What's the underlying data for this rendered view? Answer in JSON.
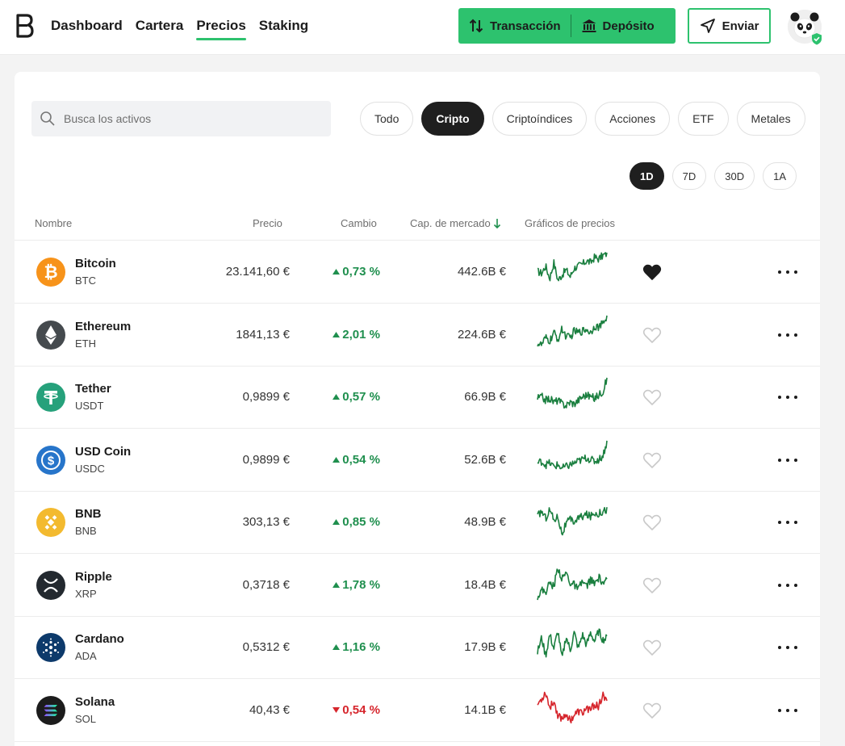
{
  "nav": {
    "items": [
      {
        "label": "Dashboard",
        "active": false
      },
      {
        "label": "Cartera",
        "active": false
      },
      {
        "label": "Precios",
        "active": true
      },
      {
        "label": "Staking",
        "active": false
      }
    ]
  },
  "actions": {
    "transaction_label": "Transacción",
    "deposit_label": "Depósito",
    "send_label": "Enviar",
    "accent": "#2dc26e"
  },
  "search": {
    "placeholder": "Busca los activos"
  },
  "filters": [
    {
      "label": "Todo",
      "active": false
    },
    {
      "label": "Cripto",
      "active": true
    },
    {
      "label": "Criptoíndices",
      "active": false
    },
    {
      "label": "Acciones",
      "active": false
    },
    {
      "label": "ETF",
      "active": false
    },
    {
      "label": "Metales",
      "active": false
    }
  ],
  "periods": [
    {
      "label": "1D",
      "active": true
    },
    {
      "label": "7D",
      "active": false
    },
    {
      "label": "30D",
      "active": false
    },
    {
      "label": "1A",
      "active": false
    }
  ],
  "table": {
    "columns": {
      "name": "Nombre",
      "price": "Precio",
      "change": "Cambio",
      "mcap": "Cap. de mercado",
      "chart": "Gráficos de precios"
    },
    "rows": [
      {
        "name": "Bitcoin",
        "symbol": "BTC",
        "price": "23.141,60 €",
        "change": "0,73 %",
        "direction": "up",
        "mcap": "442.6B €",
        "favorite": true,
        "icon": "bitcoin-icon",
        "color": "#f7931a",
        "trend": [
          0.45,
          0.4,
          0.6,
          0.25,
          0.7,
          0.2,
          0.35,
          0.5,
          0.3,
          0.55,
          0.6,
          0.65,
          0.75,
          0.7,
          0.85,
          0.8,
          0.9,
          0.95
        ]
      },
      {
        "name": "Ethereum",
        "symbol": "ETH",
        "price": "1841,13 €",
        "change": "2,01 %",
        "direction": "up",
        "mcap": "224.6B €",
        "favorite": false,
        "icon": "ethereum-icon",
        "color": "#454a4e",
        "trend": [
          0.2,
          0.15,
          0.35,
          0.25,
          0.5,
          0.3,
          0.6,
          0.4,
          0.35,
          0.55,
          0.5,
          0.55,
          0.6,
          0.5,
          0.7,
          0.65,
          0.75,
          0.95
        ]
      },
      {
        "name": "Tether",
        "symbol": "USDT",
        "price": "0,9899 €",
        "change": "0,57 %",
        "direction": "up",
        "mcap": "66.9B €",
        "favorite": false,
        "icon": "tether-icon",
        "color": "#26a17b",
        "trend": [
          0.4,
          0.45,
          0.35,
          0.4,
          0.3,
          0.35,
          0.25,
          0.2,
          0.3,
          0.25,
          0.35,
          0.45,
          0.5,
          0.45,
          0.4,
          0.5,
          0.6,
          0.95
        ]
      },
      {
        "name": "USD Coin",
        "symbol": "USDC",
        "price": "0,9899 €",
        "change": "0,54 %",
        "direction": "up",
        "mcap": "52.6B €",
        "favorite": false,
        "icon": "usd-coin-icon",
        "color": "#2775ca",
        "trend": [
          0.35,
          0.4,
          0.3,
          0.35,
          0.25,
          0.3,
          0.2,
          0.25,
          0.3,
          0.35,
          0.4,
          0.45,
          0.5,
          0.45,
          0.4,
          0.45,
          0.55,
          0.95
        ]
      },
      {
        "name": "BNB",
        "symbol": "BNB",
        "price": "303,13 €",
        "change": "0,85 %",
        "direction": "up",
        "mcap": "48.9B €",
        "favorite": false,
        "icon": "bnb-icon",
        "color": "#f3ba2f",
        "trend": [
          0.6,
          0.75,
          0.55,
          0.8,
          0.5,
          0.6,
          0.1,
          0.4,
          0.5,
          0.45,
          0.55,
          0.6,
          0.65,
          0.6,
          0.7,
          0.68,
          0.75,
          0.8
        ]
      },
      {
        "name": "Ripple",
        "symbol": "XRP",
        "price": "0,3718 €",
        "change": "1,78 %",
        "direction": "up",
        "mcap": "18.4B €",
        "favorite": false,
        "icon": "ripple-icon",
        "color": "#23292f",
        "trend": [
          0.1,
          0.3,
          0.25,
          0.5,
          0.4,
          0.95,
          0.6,
          0.8,
          0.5,
          0.45,
          0.3,
          0.55,
          0.4,
          0.6,
          0.45,
          0.65,
          0.5,
          0.55
        ]
      },
      {
        "name": "Cardano",
        "symbol": "ADA",
        "price": "0,5312 €",
        "change": "1,16 %",
        "direction": "up",
        "mcap": "17.9B €",
        "favorite": false,
        "icon": "cardano-icon",
        "color": "#0d3a6b",
        "trend": [
          0.3,
          0.7,
          0.2,
          0.8,
          0.4,
          0.9,
          0.1,
          0.75,
          0.35,
          0.85,
          0.4,
          0.8,
          0.5,
          0.85,
          0.6,
          0.9,
          0.65,
          0.7
        ]
      },
      {
        "name": "Solana",
        "symbol": "SOL",
        "price": "40,43 €",
        "change": "0,54 %",
        "direction": "down",
        "mcap": "14.1B €",
        "favorite": false,
        "icon": "solana-icon",
        "color": "#1c1c1c",
        "trend": [
          0.6,
          0.75,
          0.95,
          0.5,
          0.7,
          0.3,
          0.2,
          0.35,
          0.15,
          0.3,
          0.4,
          0.35,
          0.5,
          0.45,
          0.6,
          0.55,
          0.85,
          0.65
        ]
      }
    ]
  },
  "colors": {
    "up": "#1f8f4e",
    "down": "#d6252c",
    "spark_up": "#1a7f3f",
    "spark_down": "#d6252c"
  }
}
